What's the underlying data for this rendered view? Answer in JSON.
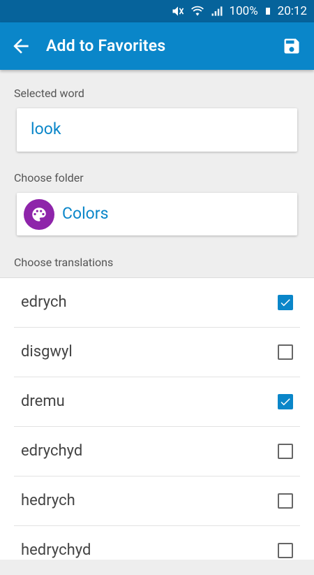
{
  "status": {
    "battery": "100%",
    "time": "20:12"
  },
  "appbar": {
    "title": "Add to Favorites"
  },
  "selected_word": {
    "label": "Selected word",
    "value": "look"
  },
  "folder": {
    "label": "Choose folder",
    "value": "Colors",
    "icon_color": "#8e24aa"
  },
  "translations": {
    "label": "Choose translations",
    "items": [
      {
        "text": "edrych",
        "checked": true
      },
      {
        "text": "disgwyl",
        "checked": false
      },
      {
        "text": "dremu",
        "checked": true
      },
      {
        "text": "edrychyd",
        "checked": false
      },
      {
        "text": "hedrych",
        "checked": false
      },
      {
        "text": "hedrychyd",
        "checked": false
      }
    ]
  },
  "colors": {
    "accent": "#0a86c9",
    "statusbar": "#06639b"
  }
}
